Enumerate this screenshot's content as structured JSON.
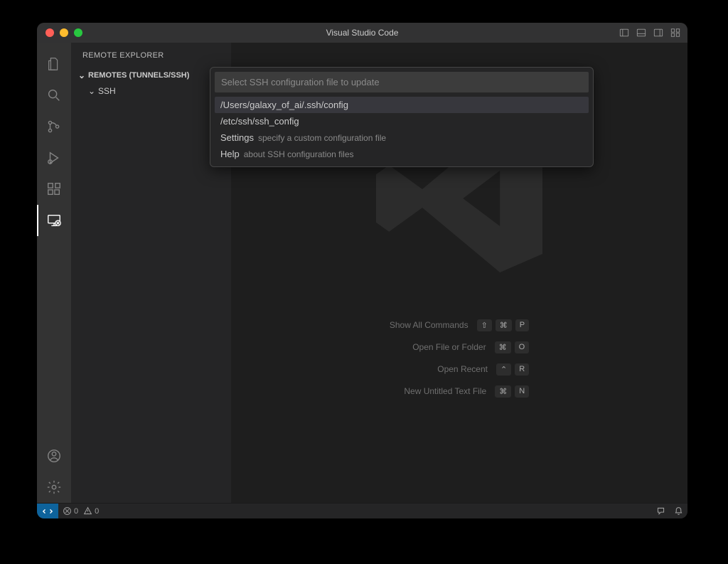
{
  "titlebar": {
    "title": "Visual Studio Code"
  },
  "sidebar": {
    "title": "REMOTE EXPLORER",
    "section": "REMOTES (TUNNELS/SSH)",
    "child": "SSH"
  },
  "quickpick": {
    "placeholder": "Select SSH configuration file to update",
    "items": [
      {
        "label": "/Users/galaxy_of_ai/.ssh/config",
        "desc": ""
      },
      {
        "label": "/etc/ssh/ssh_config",
        "desc": ""
      },
      {
        "label": "Settings",
        "desc": "specify a custom configuration file"
      },
      {
        "label": "Help",
        "desc": "about SSH configuration files"
      }
    ]
  },
  "watermark": {
    "hints": [
      {
        "label": "Show All Commands",
        "keys": [
          "⇧",
          "⌘",
          "P"
        ]
      },
      {
        "label": "Open File or Folder",
        "keys": [
          "⌘",
          "O"
        ]
      },
      {
        "label": "Open Recent",
        "keys": [
          "⌃",
          "R"
        ]
      },
      {
        "label": "New Untitled Text File",
        "keys": [
          "⌘",
          "N"
        ]
      }
    ]
  },
  "statusbar": {
    "errors": "0",
    "warnings": "0"
  }
}
